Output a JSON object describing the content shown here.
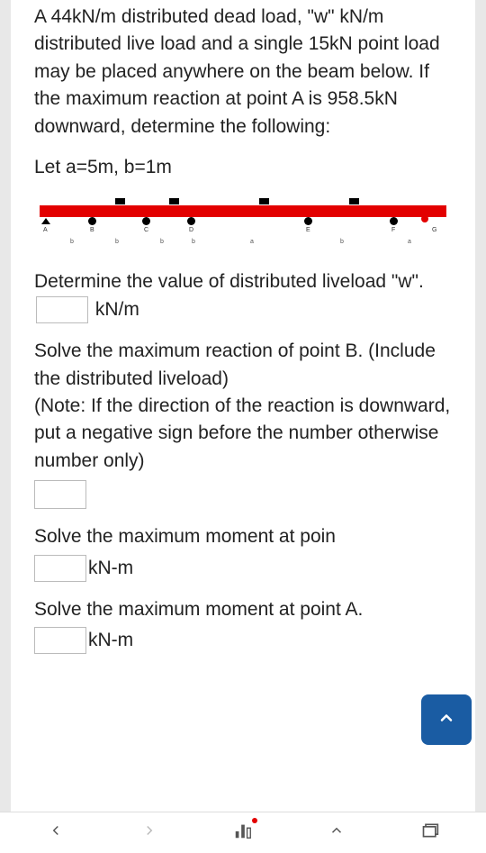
{
  "question": {
    "main_text": "A 44kN/m distributed dead load, \"w\" kN/m distributed live load and a single 15kN point load may be placed anywhere on the beam below. If the maximum reaction at point A is 958.5kN downward, determine the following:",
    "let_text": "Let a=5m, b=1m",
    "beam": {
      "nodes": [
        "A",
        "B",
        "C",
        "D",
        "E",
        "F",
        "G"
      ],
      "dims": [
        "b",
        "b",
        "b",
        "b",
        "a",
        "b",
        "a"
      ]
    },
    "sub1": {
      "pre": "Determine the value of distributed liveload \"w\".",
      "unit": "kN/m"
    },
    "sub2": {
      "text": "Solve the maximum reaction of point B. (Include the distributed liveload)\n(Note: If the direction of the reaction is downward, put a negative sign before the number otherwise number only)"
    },
    "sub3": {
      "text_truncated": "Solve the maximum moment at poin",
      "unit": "kN-m"
    },
    "sub4": {
      "text": "Solve the maximum moment at point A.",
      "unit": "kN-m"
    }
  }
}
